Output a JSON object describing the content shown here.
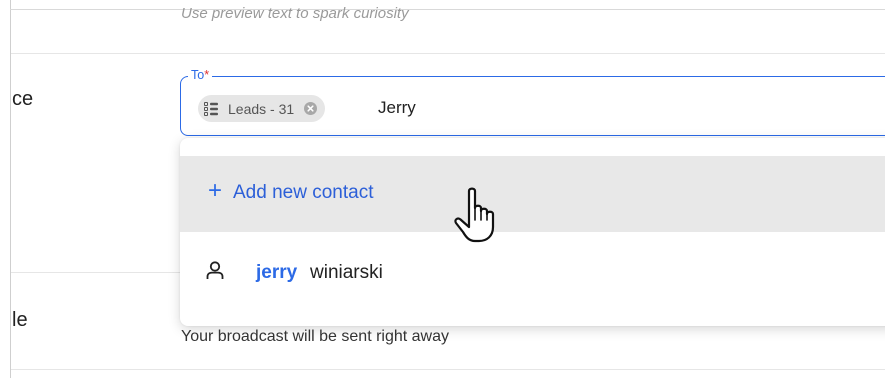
{
  "subject": {
    "preview_hint": "Use preview text to spark curiosity"
  },
  "rows": {
    "audience_label_fragment": "ce",
    "schedule_label_fragment": "le"
  },
  "to_field": {
    "legend": "To",
    "required_marker": "*",
    "chip": {
      "label": "Leads - 31",
      "icon": "list-icon",
      "remove_icon": "remove-chip-icon"
    },
    "typed_value": "Jerry"
  },
  "dropdown": {
    "add_new": {
      "icon": "plus-icon",
      "label": "Add new contact"
    },
    "results": [
      {
        "icon": "person-icon",
        "match": "jerry",
        "rest": " winiarski"
      }
    ]
  },
  "schedule": {
    "description": "Your broadcast will be sent right away"
  },
  "colors": {
    "accent": "#2c6ae6",
    "highlight_row": "#e8e8e8",
    "chip_bg": "#e6e6e6",
    "required": "#e03131"
  }
}
